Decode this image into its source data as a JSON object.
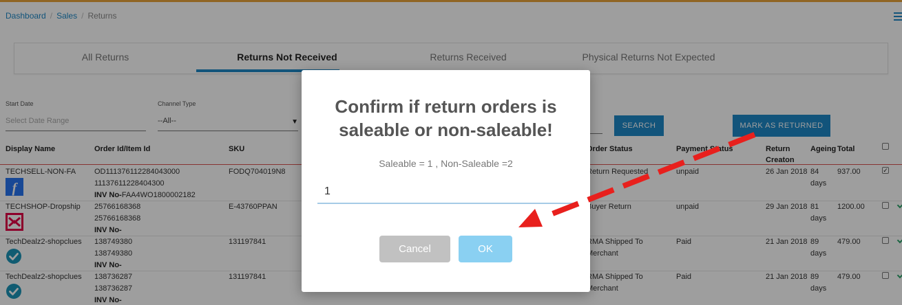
{
  "breadcrumb": {
    "home": "Dashboard",
    "section": "Sales",
    "current": "Returns"
  },
  "tabs": [
    {
      "label": "All Returns"
    },
    {
      "label": "Returns Not Received"
    },
    {
      "label": "Returns Received"
    },
    {
      "label": "Physical Returns Not Expected"
    }
  ],
  "filters": {
    "start_date_label": "Start Date",
    "start_date_placeholder": "Select Date Range",
    "channel_type_label": "Channel Type",
    "channel_type_value": "--All--"
  },
  "buttons": {
    "search": "SEARCH",
    "mark_as_returned": "MARK AS RETURNED"
  },
  "table": {
    "headers": {
      "display_name": "Display Name",
      "order_id": "Order Id/Item Id",
      "sku": "SKU",
      "order_status": "Order Status",
      "payment_status": "Payment Status",
      "return_creation": "Return Creaton",
      "ageing": "Ageing",
      "total": "Total"
    },
    "rows": [
      {
        "display_name": "TECHSELL-NON-FA",
        "order_id": "OD111376112284043000",
        "item_id": "11137611228404300",
        "inv_label": "INV No-",
        "inv_value": "FAA4WO1800002182",
        "sku": "FODQ704019N8",
        "order_status": "Return Requested",
        "payment_status": "unpaid",
        "return_date": "26 Jan 2018",
        "ageing": "84",
        "ageing_unit": "days",
        "total": "937.00",
        "checked": true,
        "channel_icon": "flipkart-icon"
      },
      {
        "display_name": "TECHSHOP-Dropship",
        "order_id": "25766168368",
        "item_id": "25766168368",
        "inv_label": "INV No-",
        "inv_value": "",
        "sku": "E-43760PPAN",
        "order_status": "Buyer Return",
        "payment_status": "unpaid",
        "return_date": "29 Jan 2018",
        "ageing": "81",
        "ageing_unit": "days",
        "total": "1200.00",
        "checked": false,
        "channel_icon": "snapdeal-icon"
      },
      {
        "display_name": "TechDealz2-shopclues",
        "order_id": "138749380",
        "item_id": "138749380",
        "inv_label": "INV No-",
        "inv_value": "",
        "sku": "131197841",
        "order_status": "RMA Shipped To Merchant",
        "payment_status": "Paid",
        "return_date": "21 Jan 2018",
        "ageing": "89",
        "ageing_unit": "days",
        "total": "479.00",
        "checked": false,
        "channel_icon": "shopclues-check-icon"
      },
      {
        "display_name": "TechDealz2-shopclues",
        "order_id": "138736287",
        "item_id": "138736287",
        "inv_label": "INV No-",
        "inv_value": "",
        "sku": "131197841",
        "order_status": "RMA Shipped To Merchant",
        "payment_status": "Paid",
        "return_date": "21 Jan 2018",
        "ageing": "89",
        "ageing_unit": "days",
        "total": "479.00",
        "checked": false,
        "channel_icon": "shopclues-check-icon"
      }
    ]
  },
  "modal": {
    "title": "Confirm if return orders is saleable or non-saleable!",
    "subtitle": "Saleable = 1 , Non-Saleable =2",
    "input_value": "1",
    "cancel_label": "Cancel",
    "ok_label": "OK"
  },
  "colors": {
    "accent": "#1e88c7",
    "ok_button": "#8ad0f2",
    "cancel_button": "#c1c1c1",
    "annotation_arrow": "#e8201d"
  }
}
